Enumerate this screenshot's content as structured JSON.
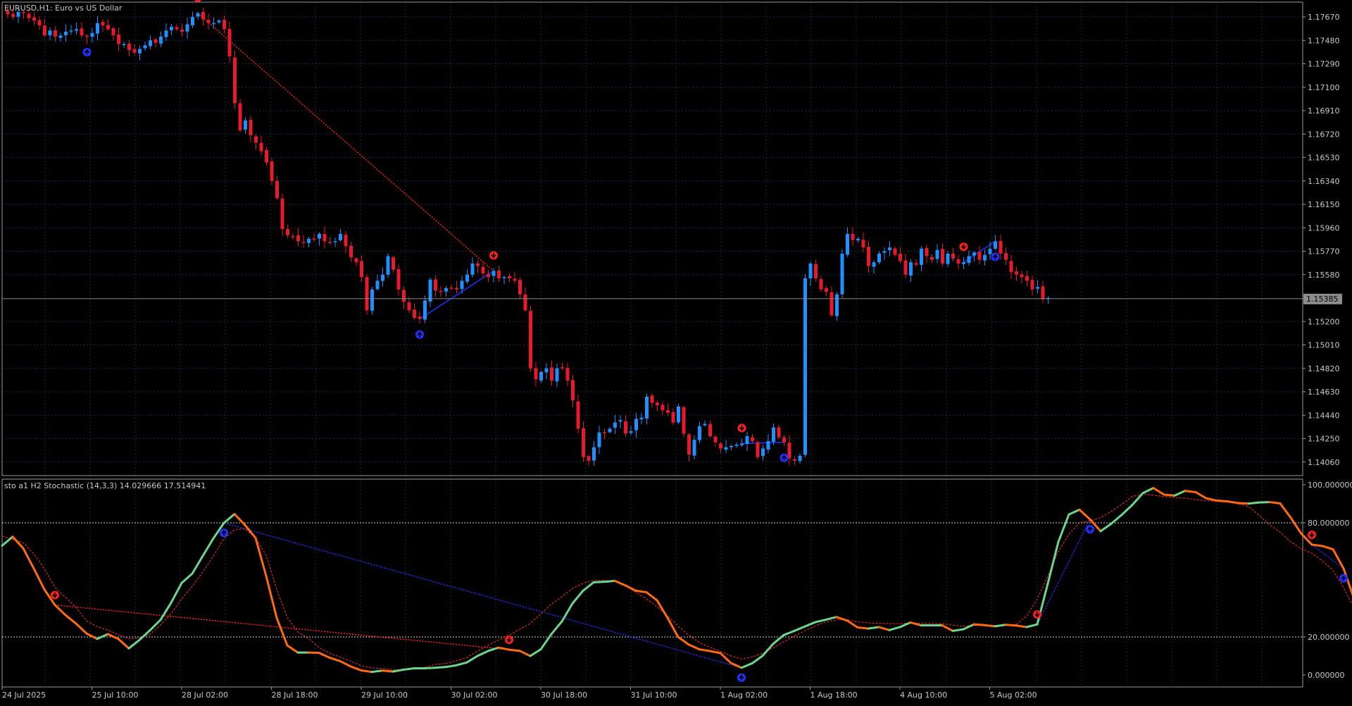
{
  "main_panel": {
    "title_symbol": "EURUSD",
    "title_rest": ",H1:  Euro vs US Dollar",
    "price_ticks": [
      "1.17670",
      "1.17480",
      "1.17290",
      "1.17100",
      "1.16910",
      "1.16720",
      "1.16530",
      "1.16340",
      "1.16150",
      "1.15960",
      "1.15770",
      "1.15580",
      "1.15200",
      "1.15010",
      "1.14820",
      "1.14630",
      "1.14440",
      "1.14250",
      "1.14060"
    ],
    "current_price": "1.15385"
  },
  "sub_panel": {
    "title": "sto a1 H2  Stochastic (14,3,3) 14.029666 17.514941",
    "ticks": [
      "100.000000",
      "80.000000",
      "20.000000",
      "0.000000"
    ]
  },
  "time_axis": {
    "labels": [
      "24 Jul 2025",
      "25 Jul 10:00",
      "28 Jul 02:00",
      "28 Jul 18:00",
      "29 Jul 10:00",
      "30 Jul 02:00",
      "30 Jul 18:00",
      "31 Jul 10:00",
      "1 Aug 02:00",
      "1 Aug 18:00",
      "4 Aug 10:00",
      "5 Aug 02:00"
    ]
  },
  "colors": {
    "background": "#000000",
    "grid": "#1c2a4a",
    "bull_candle": "#1e90ff",
    "bear_candle": "#e8192c",
    "stoch_up": "#6dd58c",
    "stoch_down": "#ff6a13",
    "signal_line": "#ff3030",
    "div_bull": "#2233ff",
    "div_bear": "#ff2020",
    "axis_text": "#c8c8c8",
    "level_line": "#d8d8d8"
  },
  "chart_data": [
    {
      "type": "candlestick",
      "title": "EURUSD,H1:  Euro vs US Dollar",
      "ylim": [
        1.1395,
        1.1779
      ],
      "current_price": 1.15385,
      "series": [
        {
          "name": "EURUSD",
          "close": [
            1.1769,
            1.1767,
            1.1771,
            1.177,
            1.1766,
            1.1764,
            1.176,
            1.1752,
            1.1756,
            1.1751,
            1.1752,
            1.1755,
            1.1756,
            1.1757,
            1.1752,
            1.1751,
            1.1754,
            1.1762,
            1.176,
            1.1757,
            1.1752,
            1.1745,
            1.1745,
            1.174,
            1.1738,
            1.1741,
            1.1744,
            1.1748,
            1.1746,
            1.1751,
            1.1756,
            1.1759,
            1.1757,
            1.1755,
            1.1761,
            1.1767,
            1.177,
            1.1765,
            1.1762,
            1.1762,
            1.1764,
            1.1757,
            1.1735,
            1.1697,
            1.1675,
            1.1683,
            1.1671,
            1.1665,
            1.1658,
            1.1649,
            1.1634,
            1.162,
            1.1595,
            1.159,
            1.1589,
            1.1585,
            1.1584,
            1.1587,
            1.1587,
            1.1591,
            1.1585,
            1.1584,
            1.1585,
            1.1591,
            1.1581,
            1.1572,
            1.1568,
            1.1556,
            1.1529,
            1.1546,
            1.1553,
            1.1558,
            1.1573,
            1.1562,
            1.1546,
            1.1536,
            1.1529,
            1.1523,
            1.1522,
            1.1537,
            1.1554,
            1.1545,
            1.1544,
            1.1547,
            1.1547,
            1.1546,
            1.1553,
            1.1558,
            1.1567,
            1.1565,
            1.1559,
            1.1556,
            1.1561,
            1.1555,
            1.1556,
            1.1555,
            1.1553,
            1.1542,
            1.1529,
            1.1482,
            1.1473,
            1.1479,
            1.1482,
            1.1472,
            1.1482,
            1.1482,
            1.1472,
            1.1456,
            1.1433,
            1.141,
            1.1407,
            1.1418,
            1.143,
            1.143,
            1.1433,
            1.1438,
            1.144,
            1.1429,
            1.1431,
            1.1441,
            1.1442,
            1.1459,
            1.1454,
            1.1452,
            1.1448,
            1.1446,
            1.1438,
            1.1451,
            1.1429,
            1.1412,
            1.1424,
            1.1435,
            1.1437,
            1.1427,
            1.1422,
            1.1417,
            1.1418,
            1.1419,
            1.142,
            1.1421,
            1.1427,
            1.1423,
            1.141,
            1.1417,
            1.1423,
            1.1434,
            1.1426,
            1.1422,
            1.1409,
            1.1407,
            1.1411,
            1.1555,
            1.1567,
            1.1555,
            1.1546,
            1.1544,
            1.1525,
            1.1542,
            1.1575,
            1.1591,
            1.1586,
            1.1587,
            1.158,
            1.1565,
            1.1568,
            1.1575,
            1.1577,
            1.158,
            1.1574,
            1.1569,
            1.1558,
            1.1568,
            1.1566,
            1.1579,
            1.1573,
            1.157,
            1.1578,
            1.1567,
            1.1575,
            1.1571,
            1.1567,
            1.1568,
            1.1573,
            1.1576,
            1.157,
            1.1574,
            1.1579,
            1.1585,
            1.1575,
            1.157,
            1.156,
            1.1558,
            1.1556,
            1.1553,
            1.1546,
            1.1548,
            1.1538,
            1.1539
          ]
        }
      ],
      "divergence_signals": [
        {
          "kind": "bearish",
          "bar": 36
        },
        {
          "kind": "bullish",
          "bar": 15
        },
        {
          "kind": "bullish",
          "bar": 78
        },
        {
          "kind": "bearish",
          "bar": 92
        },
        {
          "kind": "bearish",
          "bar": 139
        },
        {
          "kind": "bullish",
          "bar": 147
        },
        {
          "kind": "bearish",
          "bar": 181
        },
        {
          "kind": "bullish",
          "bar": 187
        }
      ]
    },
    {
      "type": "line",
      "title": "sto a1 H2  Stochastic (14,3,3) 14.029666 17.514941",
      "ylim": [
        0,
        100
      ],
      "levels": [
        80,
        20
      ],
      "series": [
        {
          "name": "main",
          "values": [
            68.0,
            72.7,
            66.6,
            56.0,
            45.0,
            36.8,
            31.5,
            27.0,
            21.8,
            19.0,
            21.5,
            19.0,
            14.0,
            18.4,
            23.5,
            29.0,
            38.0,
            48.4,
            53.3,
            62.6,
            71.8,
            79.9,
            84.6,
            78.8,
            72.0,
            52.0,
            30.0,
            15.5,
            11.8,
            11.8,
            11.6,
            9.1,
            7.3,
            4.5,
            2.4,
            1.6,
            2.3,
            1.8,
            2.8,
            3.5,
            3.5,
            3.8,
            4.2,
            5.1,
            6.6,
            10.0,
            12.6,
            14.4,
            13.3,
            12.7,
            10.0,
            13.5,
            21.5,
            28.2,
            37.6,
            44.3,
            48.7,
            49.0,
            49.5,
            47.1,
            44.3,
            43.5,
            39.3,
            30.0,
            20.0,
            16.0,
            13.5,
            12.6,
            11.5,
            6.3,
            3.8,
            6.1,
            10.1,
            16.4,
            21.0,
            23.2,
            25.5,
            27.8,
            29.1,
            30.5,
            28.6,
            25.0,
            24.4,
            25.2,
            23.6,
            25.2,
            27.6,
            26.1,
            26.1,
            26.1,
            23.2,
            24.0,
            26.6,
            26.2,
            25.6,
            26.4,
            26.0,
            25.2,
            26.6,
            48.0,
            70.0,
            84.4,
            86.9,
            81.8,
            75.6,
            79.5,
            84.2,
            89.4,
            95.6,
            98.3,
            94.8,
            94.3,
            96.8,
            96.1,
            92.9,
            91.7,
            91.3,
            90.4,
            90.1,
            90.7,
            90.9,
            90.2,
            82.7,
            74.3,
            68.5,
            67.8,
            66.1,
            56.0,
            40.0,
            30.0,
            23.4,
            21.0,
            18.0,
            17.5
          ]
        },
        {
          "name": "signal",
          "values": [
            73.0,
            71.3,
            69.6,
            63.7,
            55.9,
            46.1,
            40.8,
            35.5,
            28.4,
            25.4,
            23.6,
            21.3,
            19.0,
            19.5,
            21.3,
            26.3,
            32.2,
            40.0,
            46.7,
            54.1,
            62.6,
            71.7,
            76.3,
            76.9,
            72.0,
            62.9,
            45.0,
            30.3,
            22.6,
            19.2,
            14.5,
            11.4,
            9.5,
            7.2,
            5.0,
            3.7,
            3.4,
            2.7,
            2.8,
            3.4,
            4.1,
            5.5,
            6.1,
            7.4,
            9.2,
            12.5,
            15.5,
            18.5,
            21.0,
            24.0,
            27.1,
            32.2,
            37.2,
            41.2,
            45.5,
            48.2,
            49.8,
            49.7,
            49.1,
            46.9,
            43.5,
            40.0,
            36.0,
            31.0,
            25.7,
            21.0,
            17.1,
            14.6,
            12.5,
            10.0,
            8.4,
            9.4,
            11.5,
            14.2,
            17.4,
            20.5,
            23.2,
            25.9,
            28.0,
            29.0,
            29.1,
            27.9,
            27.4,
            27.2,
            27.0,
            27.0,
            27.2,
            27.3,
            27.2,
            27.0,
            26.2,
            25.7,
            26.0,
            26.0,
            25.7,
            26.1,
            26.5,
            31.0,
            40.0,
            52.0,
            65.0,
            74.0,
            80.0,
            81.0,
            82.7,
            86.0,
            89.7,
            93.8,
            95.2,
            94.5,
            93.8,
            93.3,
            92.9,
            92.2,
            91.6,
            91.2,
            90.8,
            90.0,
            88.5,
            84.0,
            79.0,
            75.0,
            70.0,
            66.4,
            64.0,
            60.0,
            55.0,
            46.0,
            35.0,
            27.0,
            21.0,
            18.5,
            17.5
          ]
        }
      ],
      "divergence_signals": [
        {
          "kind": "bearish",
          "idx": 5
        },
        {
          "kind": "bullish",
          "idx": 21
        },
        {
          "kind": "bearish",
          "idx": 48
        },
        {
          "kind": "bullish",
          "idx": 70
        },
        {
          "kind": "bearish",
          "idx": 98
        },
        {
          "kind": "bullish",
          "idx": 103
        },
        {
          "kind": "bearish",
          "idx": 124
        },
        {
          "kind": "bullish",
          "idx": 127
        }
      ]
    }
  ]
}
